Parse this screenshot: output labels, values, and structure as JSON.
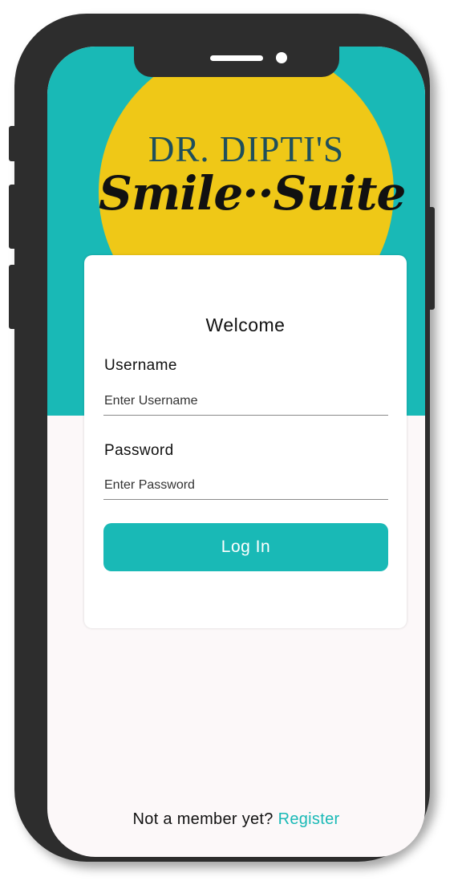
{
  "logo": {
    "line1": "DR. DIPTI'S",
    "line2": "Smile··Suite"
  },
  "login": {
    "title": "Welcome",
    "username_label": "Username",
    "username_placeholder": "Enter Username",
    "username_value": "",
    "password_label": "Password",
    "password_placeholder": "Enter Password",
    "password_value": "",
    "button_label": "Log In"
  },
  "footer": {
    "prompt": "Not a member yet?",
    "register_label": "Register"
  },
  "colors": {
    "teal": "#19b9b6",
    "yellow": "#efc817",
    "logo_text": "#1f4f5b",
    "background": "#fcf8f9"
  },
  "icons": {
    "camera": "camera-icon",
    "speaker": "speaker-icon"
  }
}
